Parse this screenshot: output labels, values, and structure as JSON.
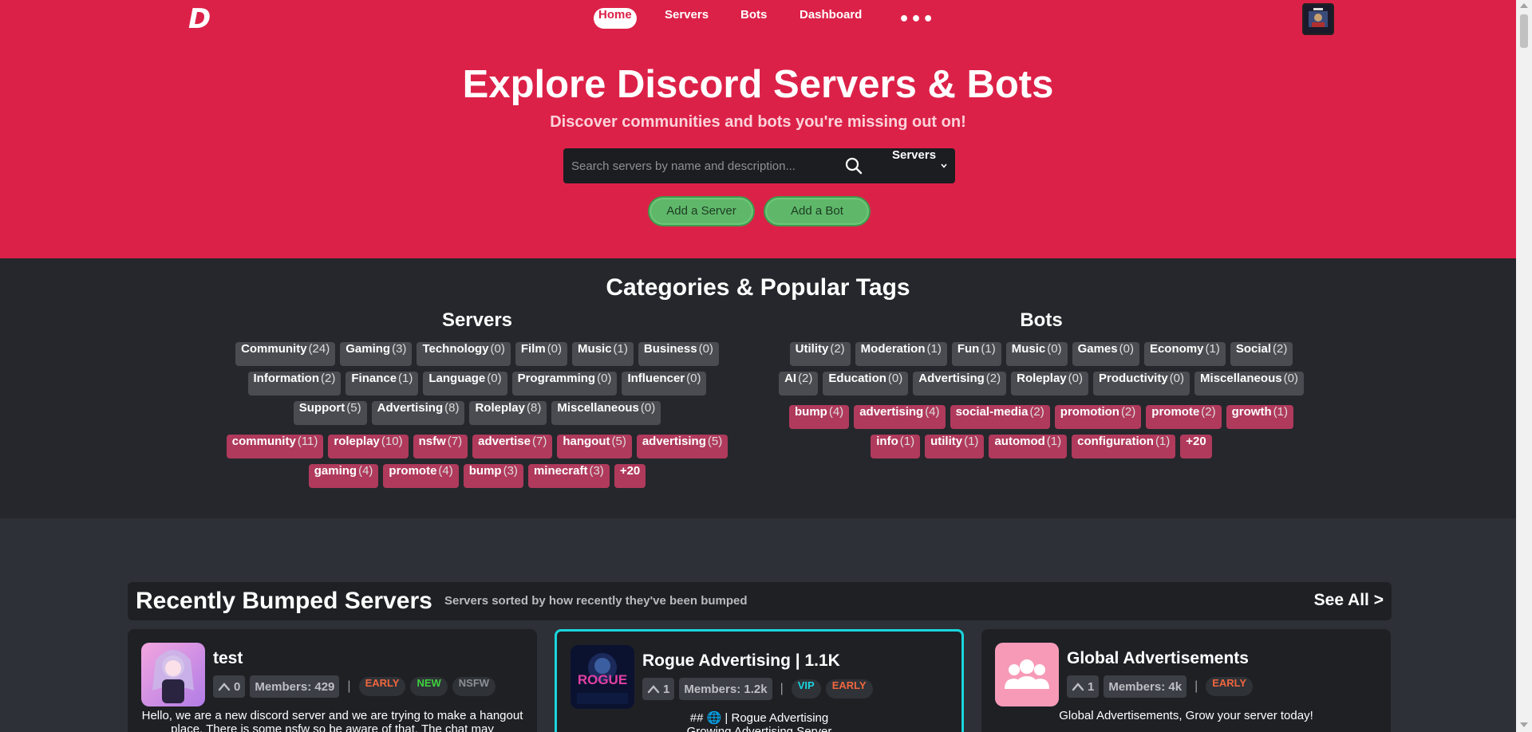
{
  "logo": "D",
  "nav": {
    "items": [
      "Home",
      "Servers",
      "Bots",
      "Dashboard"
    ],
    "more_icon": "more-icon"
  },
  "hero": {
    "title": "Explore Discord Servers & Bots",
    "subtitle": "Discover communities and bots you're missing out on!",
    "search_placeholder": "Search servers by name and description...",
    "search_type": "Servers",
    "add_server": "Add a Server",
    "add_bot": "Add a Bot"
  },
  "categories": {
    "title": "Categories & Popular Tags",
    "servers_title": "Servers",
    "bots_title": "Bots",
    "server_categories": [
      [
        [
          "Community",
          "(24)"
        ],
        [
          "Gaming",
          "(3)"
        ],
        [
          "Technology",
          "(0)"
        ],
        [
          "Film",
          "(0)"
        ],
        [
          "Music",
          "(1)"
        ],
        [
          "Business",
          "(0)"
        ]
      ],
      [
        [
          "Information",
          "(2)"
        ],
        [
          "Finance",
          "(1)"
        ],
        [
          "Language",
          "(0)"
        ],
        [
          "Programming",
          "(0)"
        ],
        [
          "Influencer",
          "(0)"
        ]
      ],
      [
        [
          "Support",
          "(5)"
        ],
        [
          "Advertising",
          "(8)"
        ],
        [
          "Roleplay",
          "(8)"
        ],
        [
          "Miscellaneous",
          "(0)"
        ]
      ]
    ],
    "server_tags": [
      [
        [
          "community",
          "(11)"
        ],
        [
          "roleplay",
          "(10)"
        ],
        [
          "nsfw",
          "(7)"
        ],
        [
          "advertise",
          "(7)"
        ],
        [
          "hangout",
          "(5)"
        ],
        [
          "advertising",
          "(5)"
        ]
      ],
      [
        [
          "gaming",
          "(4)"
        ],
        [
          "promote",
          "(4)"
        ],
        [
          "bump",
          "(3)"
        ],
        [
          "minecraft",
          "(3)"
        ],
        [
          "+20",
          ""
        ]
      ]
    ],
    "bot_categories": [
      [
        [
          "Utility",
          "(2)"
        ],
        [
          "Moderation",
          "(1)"
        ],
        [
          "Fun",
          "(1)"
        ],
        [
          "Music",
          "(0)"
        ],
        [
          "Games",
          "(0)"
        ],
        [
          "Economy",
          "(1)"
        ],
        [
          "Social",
          "(2)"
        ]
      ],
      [
        [
          "AI",
          "(2)"
        ],
        [
          "Education",
          "(0)"
        ],
        [
          "Advertising",
          "(2)"
        ],
        [
          "Roleplay",
          "(0)"
        ],
        [
          "Productivity",
          "(0)"
        ],
        [
          "Miscellaneous",
          "(0)"
        ]
      ]
    ],
    "bot_tags": [
      [
        [
          "bump",
          "(4)"
        ],
        [
          "advertising",
          "(4)"
        ],
        [
          "social-media",
          "(2)"
        ],
        [
          "promotion",
          "(2)"
        ],
        [
          "promote",
          "(2)"
        ],
        [
          "growth",
          "(1)"
        ]
      ],
      [
        [
          "info",
          "(1)"
        ],
        [
          "utility",
          "(1)"
        ],
        [
          "automod",
          "(1)"
        ],
        [
          "configuration",
          "(1)"
        ],
        [
          "+20",
          ""
        ]
      ]
    ]
  },
  "recent": {
    "title": "Recently Bumped Servers",
    "dot": "·",
    "subtitle": "Servers sorted by how recently they've been bumped",
    "see_all": "See All >",
    "cards": [
      {
        "name": "test",
        "votes": "0",
        "members": "Members: 429",
        "badges": [
          [
            "EARLY",
            "#f0663e"
          ],
          [
            "NEW",
            "#3ed33e"
          ],
          [
            "NSFW",
            "#8d9096"
          ]
        ],
        "description": "Hello, we are a new discord server and we are trying to make a hangout place. There is some nsfw so be aware of that. The chat may",
        "icon_colors": [
          "#f3a6e0",
          "#b07ce6"
        ]
      },
      {
        "name": "Rogue Advertising | 1.1K",
        "votes": "1",
        "members": "Members: 1.2k",
        "badges": [
          [
            "VIP",
            "#1ad5de"
          ],
          [
            "EARLY",
            "#f0663e"
          ]
        ],
        "description": "## 🌐 | Rogue Advertising\nGrowing Advertising Server",
        "icon_text": "ROGUE",
        "icon_colors": [
          "#0b1230",
          "#e23fa5"
        ]
      },
      {
        "name": "Global Advertisements",
        "votes": "1",
        "members": "Members: 4k",
        "badges": [
          [
            "EARLY",
            "#f0663e"
          ]
        ],
        "description": "Global Advertisements, Grow your server today!",
        "icon_colors": [
          "#f79ab8",
          "#ffffff"
        ]
      }
    ]
  }
}
